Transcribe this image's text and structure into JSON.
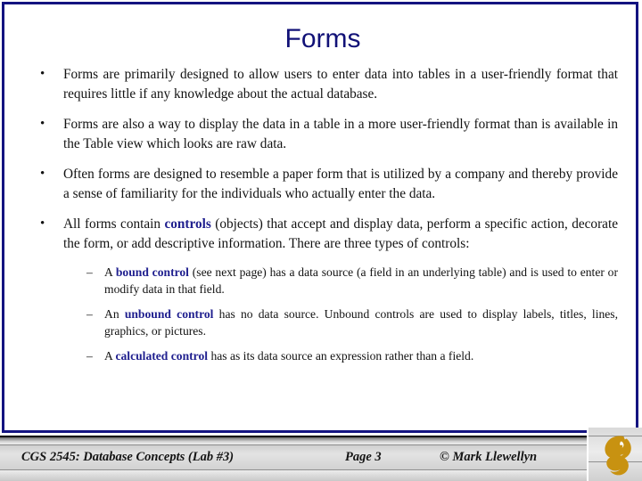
{
  "slide": {
    "title": "Forms",
    "title_color": "#111177",
    "frame_color": "#131380",
    "keyword_color": "#20208f",
    "background_color": "#ffffff"
  },
  "bullets": [
    {
      "marker": "•",
      "level": 1,
      "parts": [
        {
          "text": "Forms are primarily designed to allow users to enter data into tables in a user-friendly format that requires little if any knowledge about the actual database.",
          "style": "normal"
        }
      ]
    },
    {
      "marker": "•",
      "level": 1,
      "parts": [
        {
          "text": "Forms are also a way to display the data in a table in a more user-friendly format than is available in the Table view which looks are raw data.",
          "style": "normal"
        }
      ]
    },
    {
      "marker": "•",
      "level": 1,
      "parts": [
        {
          "text": "Often forms are designed to resemble a paper form that is utilized by a company and thereby provide a sense of familiarity for the individuals who actually enter the data.",
          "style": "normal"
        }
      ]
    },
    {
      "marker": "•",
      "level": 1,
      "parts": [
        {
          "text": "All forms contain ",
          "style": "normal"
        },
        {
          "text": "controls",
          "style": "keyword"
        },
        {
          "text": " (objects) that accept and display data, perform a specific action, decorate the form, or add descriptive information.  There are three types of controls:",
          "style": "normal"
        }
      ]
    },
    {
      "marker": "–",
      "level": 2,
      "parts": [
        {
          "text": "A ",
          "style": "normal"
        },
        {
          "text": "bound control",
          "style": "keyword"
        },
        {
          "text": " (see next page) has a data source (a field in an underlying table) and is used to enter or modify data in that field.",
          "style": "normal"
        }
      ]
    },
    {
      "marker": "–",
      "level": 2,
      "parts": [
        {
          "text": "An ",
          "style": "normal"
        },
        {
          "text": "unbound control",
          "style": "keyword"
        },
        {
          "text": " has no data source.  Unbound controls are used to display labels, titles, lines, graphics, or pictures.",
          "style": "normal"
        }
      ]
    },
    {
      "marker": "–",
      "level": 2,
      "parts": [
        {
          "text": "A ",
          "style": "normal"
        },
        {
          "text": "calculated control",
          "style": "keyword"
        },
        {
          "text": " has as its data source an expression rather than a field.",
          "style": "normal"
        }
      ]
    }
  ],
  "footer": {
    "course": "CGS 2545: Database Concepts  (Lab #3)",
    "page": "Page 3",
    "credit": "© Mark Llewellyn",
    "logo_name": "ucf-pegasus-logo",
    "logo_color": "#c89211"
  }
}
